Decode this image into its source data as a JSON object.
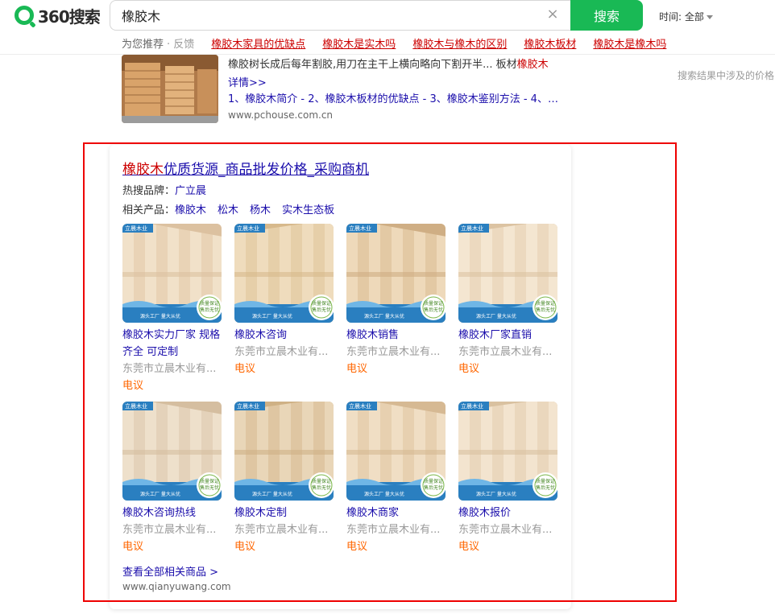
{
  "header": {
    "logo_text": "360搜索",
    "search_value": "橡胶木",
    "search_button": "搜索",
    "time_filter": "时间: 全部"
  },
  "recommend": {
    "label": "为您推荐",
    "feedback": "· 反馈",
    "links": [
      "橡胶木家具的优缺点",
      "橡胶木是实木吗",
      "橡胶木与橡木的区别",
      "橡胶木板材",
      "橡胶木是橡木吗"
    ]
  },
  "result1": {
    "desc_prefix": "橡胶树长成后每年割胶,用刀在主干上横向略向下割开半... 板材",
    "desc_hl": "橡胶木",
    "more": "详情>>",
    "links": "1、橡胶木简介 - 2、橡胶木板材的优缺点 - 3、橡胶木鉴别方法 - 4、…",
    "url": "www.pchouse.com.cn"
  },
  "side_note": "搜索结果中涉及的价格",
  "card": {
    "title_hl": "橡胶木",
    "title_rest": "优质货源_商品批发价格_采购商机",
    "hot_brand_label": "热搜品牌：",
    "hot_brand": "广立晨",
    "related_label": "相关产品：",
    "related": [
      "橡胶木",
      "松木",
      "杨木",
      "实木生态板"
    ],
    "products": [
      {
        "name": "橡胶木实力厂家 规格齐全 可定制",
        "seller": "东莞市立晨木业有...",
        "price": "电议"
      },
      {
        "name": "橡胶木咨询",
        "seller": "东莞市立晨木业有...",
        "price": "电议"
      },
      {
        "name": "橡胶木销售",
        "seller": "东莞市立晨木业有...",
        "price": "电议"
      },
      {
        "name": "橡胶木厂家直销",
        "seller": "东莞市立晨木业有...",
        "price": "电议"
      },
      {
        "name": "橡胶木咨询热线",
        "seller": "东莞市立晨木业有...",
        "price": "电议"
      },
      {
        "name": "橡胶木定制",
        "seller": "东莞市立晨木业有...",
        "price": "电议"
      },
      {
        "name": "橡胶木商家",
        "seller": "东莞市立晨木业有...",
        "price": "电议"
      },
      {
        "name": "橡胶木报价",
        "seller": "东莞市立晨木业有...",
        "price": "电议"
      }
    ],
    "badge_top": "立晨木业",
    "badge_bottom": "源头工厂 量大从优",
    "seal": "质量保证 售后无忧",
    "view_all": "查看全部相关商品 >",
    "url": "www.qianyuwang.com"
  },
  "colors": {
    "brand_green": "#19b955",
    "link": "#1a0dab",
    "highlight": "#cc0000",
    "price": "#ff6600",
    "annotation_frame": "#ee0000"
  },
  "icons": [
    "logo-icon",
    "clear-icon",
    "caret-down-icon"
  ]
}
